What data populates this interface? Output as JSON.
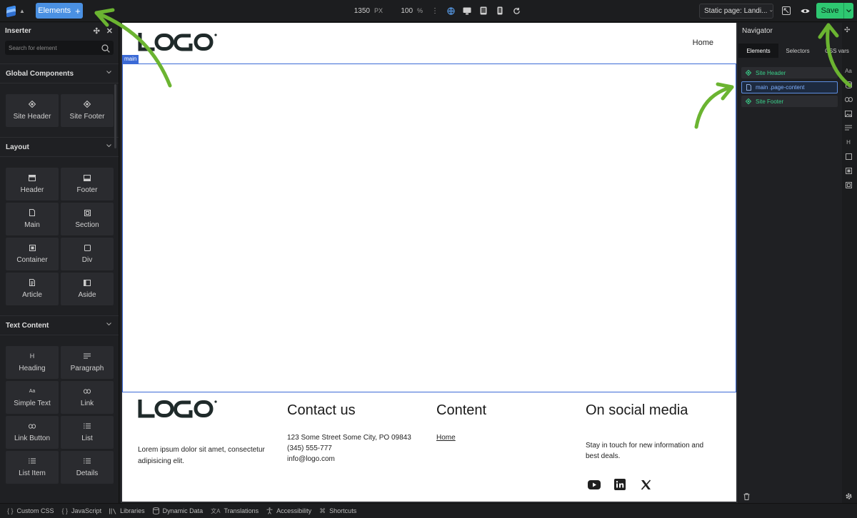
{
  "topbar": {
    "elements_label": "Elements",
    "elements_plus": "+",
    "width_value": "1350",
    "width_unit": "PX",
    "zoom_value": "100",
    "zoom_unit": "%",
    "kebab": "⋮",
    "page_select": "Static page: Landi...",
    "save_label": "Save"
  },
  "inserter": {
    "title": "Inserter",
    "search_placeholder": "Search for element",
    "sections": [
      {
        "title": "Global Components",
        "items": [
          "Site Header",
          "Site Footer"
        ]
      },
      {
        "title": "Layout",
        "items": [
          "Header",
          "Footer",
          "Main",
          "Section",
          "Container",
          "Div",
          "Article",
          "Aside"
        ]
      },
      {
        "title": "Text Content",
        "items": [
          "Heading",
          "Paragraph",
          "Simple Text",
          "Link",
          "Link Button",
          "List",
          "List Item",
          "Details"
        ]
      }
    ]
  },
  "canvas": {
    "nav_home": "Home",
    "main_tag": "main",
    "footer": {
      "description": "Lorem ipsum dolor sit amet, consectetur adipisicing elit.",
      "contact_title": "Contact us",
      "contact_lines": [
        "123 Some Street Some City, PO 09843",
        "(345) 555-777",
        "info@logo.com"
      ],
      "content_title": "Content",
      "content_link": "Home",
      "social_title": "On social media",
      "social_text": "Stay in touch for new information and best deals."
    }
  },
  "navigator": {
    "title": "Navigator",
    "tabs": [
      "Elements",
      "Selectors",
      "CSS vars"
    ],
    "tree": [
      "Site Header",
      "main .page-content",
      "Site Footer"
    ]
  },
  "bottombar": {
    "items": [
      "Custom CSS",
      "JavaScript",
      "Libraries",
      "Dynamic Data",
      "Translations",
      "Accessibility",
      "Shortcuts"
    ]
  },
  "colors": {
    "accent_blue": "#4a90e2",
    "save_green": "#2ec771",
    "selection_blue": "#3b6ad6",
    "component_green": "#39d08a",
    "arrow_green": "#6bb431"
  }
}
